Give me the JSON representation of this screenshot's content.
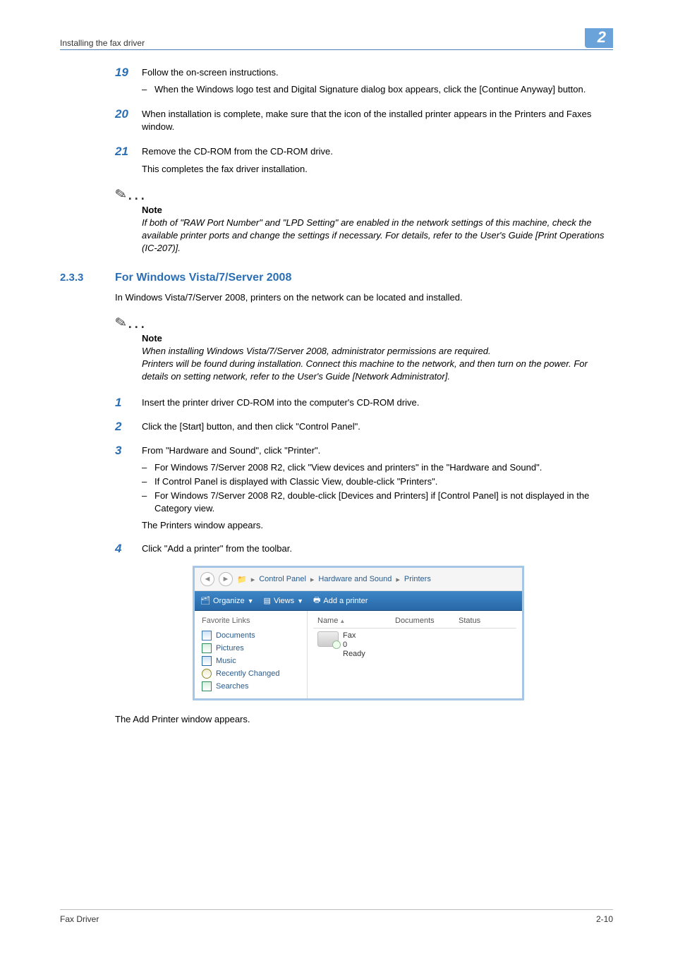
{
  "header": {
    "title": "Installing the fax driver",
    "chapter": "2"
  },
  "steps_a": [
    {
      "num": "19",
      "text": "Follow the on-screen instructions.",
      "subs": [
        "When the Windows logo test and Digital Signature dialog box appears, click the [Continue Anyway] button."
      ]
    },
    {
      "num": "20",
      "text": "When installation is complete, make sure that the icon of the installed printer appears in the Printers and Faxes window."
    },
    {
      "num": "21",
      "text": "Remove the CD-ROM from the CD-ROM drive.",
      "after": "This completes the fax driver installation."
    }
  ],
  "note1": {
    "label": "Note",
    "body": "If both of \"RAW Port Number\" and \"LPD Setting\" are enabled in the network settings of this machine, check the available printer ports and change the settings if necessary. For details, refer to the User's Guide [Print Operations (IC-207)]."
  },
  "section": {
    "num": "2.3.3",
    "title": "For Windows Vista/7/Server 2008",
    "intro": "In Windows Vista/7/Server 2008, printers on the network can be located and installed."
  },
  "note2": {
    "label": "Note",
    "lines": [
      "When installing Windows Vista/7/Server 2008, administrator permissions are required.",
      "Printers will be found during installation. Connect this machine to the network, and then turn on the power. For details on setting network, refer to the User's Guide [Network Administrator]."
    ]
  },
  "steps_b": [
    {
      "num": "1",
      "text": "Insert the printer driver CD-ROM into the computer's CD-ROM drive."
    },
    {
      "num": "2",
      "text": "Click the [Start] button, and then click \"Control Panel\"."
    },
    {
      "num": "3",
      "text": "From \"Hardware and Sound\", click \"Printer\".",
      "subs": [
        "For Windows 7/Server 2008 R2, click \"View devices and printers\" in the \"Hardware and Sound\".",
        "If Control Panel is displayed with Classic View, double-click \"Printers\".",
        "For Windows 7/Server 2008 R2, double-click [Devices and Printers] if [Control Panel] is not displayed in the Category view."
      ],
      "after": "The Printers window appears."
    },
    {
      "num": "4",
      "text": "Click \"Add a printer\" from the toolbar."
    }
  ],
  "screenshot": {
    "breadcrumb": [
      "Control Panel",
      "Hardware and Sound",
      "Printers"
    ],
    "toolbar": {
      "organize": "Organize",
      "views": "Views",
      "add": "Add a printer"
    },
    "fav_title": "Favorite Links",
    "fav_links": [
      "Documents",
      "Pictures",
      "Music",
      "Recently Changed",
      "Searches"
    ],
    "columns": {
      "name": "Name",
      "documents": "Documents",
      "status": "Status"
    },
    "device": {
      "name": "Fax",
      "docs": "0",
      "status": "Ready"
    }
  },
  "after_shot": "The Add Printer window appears.",
  "footer": {
    "left": "Fax Driver",
    "right": "2-10"
  }
}
